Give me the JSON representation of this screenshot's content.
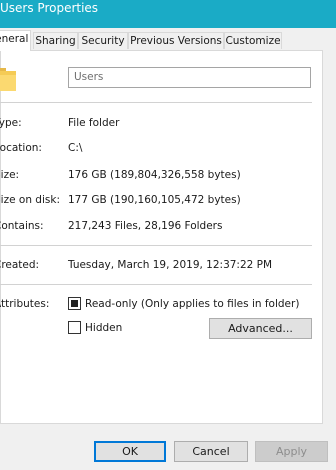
{
  "window": {
    "title": "Users Properties"
  },
  "tabs": [
    {
      "label": "General",
      "active": true
    },
    {
      "label": "Sharing",
      "active": false
    },
    {
      "label": "Security",
      "active": false
    },
    {
      "label": "Previous Versions",
      "active": false
    },
    {
      "label": "Customize",
      "active": false
    }
  ],
  "general": {
    "icon": "folder-icon",
    "name_value": "Users",
    "rows": {
      "type": {
        "label": "Type:",
        "value": "File folder"
      },
      "location": {
        "label": "Location:",
        "value": "C:\\"
      },
      "size": {
        "label": "Size:",
        "value": "176 GB (189,804,326,558 bytes)"
      },
      "size_on_disk": {
        "label": "Size on disk:",
        "value": "177 GB (190,160,105,472 bytes)"
      },
      "contains": {
        "label": "Contains:",
        "value": "217,243 Files, 28,196 Folders"
      },
      "created": {
        "label": "Created:",
        "value": "Tuesday, March 19, 2019, 12:37:22 PM"
      }
    },
    "attributes": {
      "label": "Attributes:",
      "readonly": {
        "label": "Read-only (Only applies to files in folder)",
        "state": "indeterminate"
      },
      "hidden": {
        "label": "Hidden",
        "checked": false
      },
      "advanced_label": "Advanced..."
    }
  },
  "buttons": {
    "ok": "OK",
    "cancel": "Cancel",
    "apply": "Apply"
  },
  "colors": {
    "titlebar": "#1aabc6",
    "dialog_bg": "#f0f0f0",
    "focus_border": "#0078d7"
  }
}
